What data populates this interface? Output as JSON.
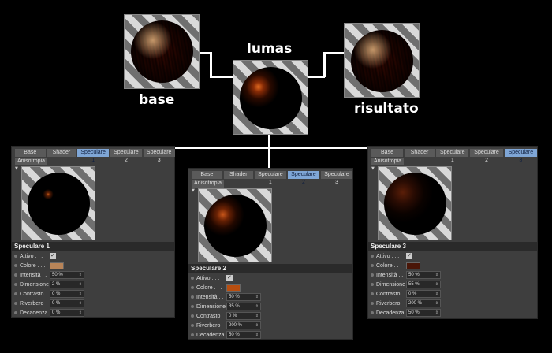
{
  "labels": {
    "base": "base",
    "lumas": "lumas",
    "risultato": "risultato"
  },
  "tabs": [
    "Base",
    "Shader",
    "Speculare 1",
    "Speculare 2",
    "Speculare 3"
  ],
  "sub_tab": "Anisotropia",
  "field_labels": {
    "attivo": "Attivo . . .",
    "colore": "Colore . . .",
    "intensita": "Intensità . .",
    "dimensione": "Dimensione",
    "contrasto": "Contrasto",
    "riverbero": "Riverbero",
    "decadenza": "Decadenza"
  },
  "panel1": {
    "title": "Speculare 1",
    "attivo": "✓",
    "colore": "#b88458",
    "intensita": "50 %",
    "dimensione": "2 %",
    "contrasto": "0 %",
    "riverbero": "0 %",
    "decadenza": "0 %"
  },
  "panel2": {
    "title": "Speculare 2",
    "attivo": "✓",
    "colore": "#b84e10",
    "intensita": "50 %",
    "dimensione": "35 %",
    "contrasto": "0 %",
    "riverbero": "200 %",
    "decadenza": "50 %"
  },
  "panel3": {
    "title": "Speculare 3",
    "attivo": "✓",
    "colore": "#4a1608",
    "intensita": "50 %",
    "dimensione": "55 %",
    "contrasto": "0 %",
    "riverbero": "200 %",
    "decadenza": "50 %"
  }
}
